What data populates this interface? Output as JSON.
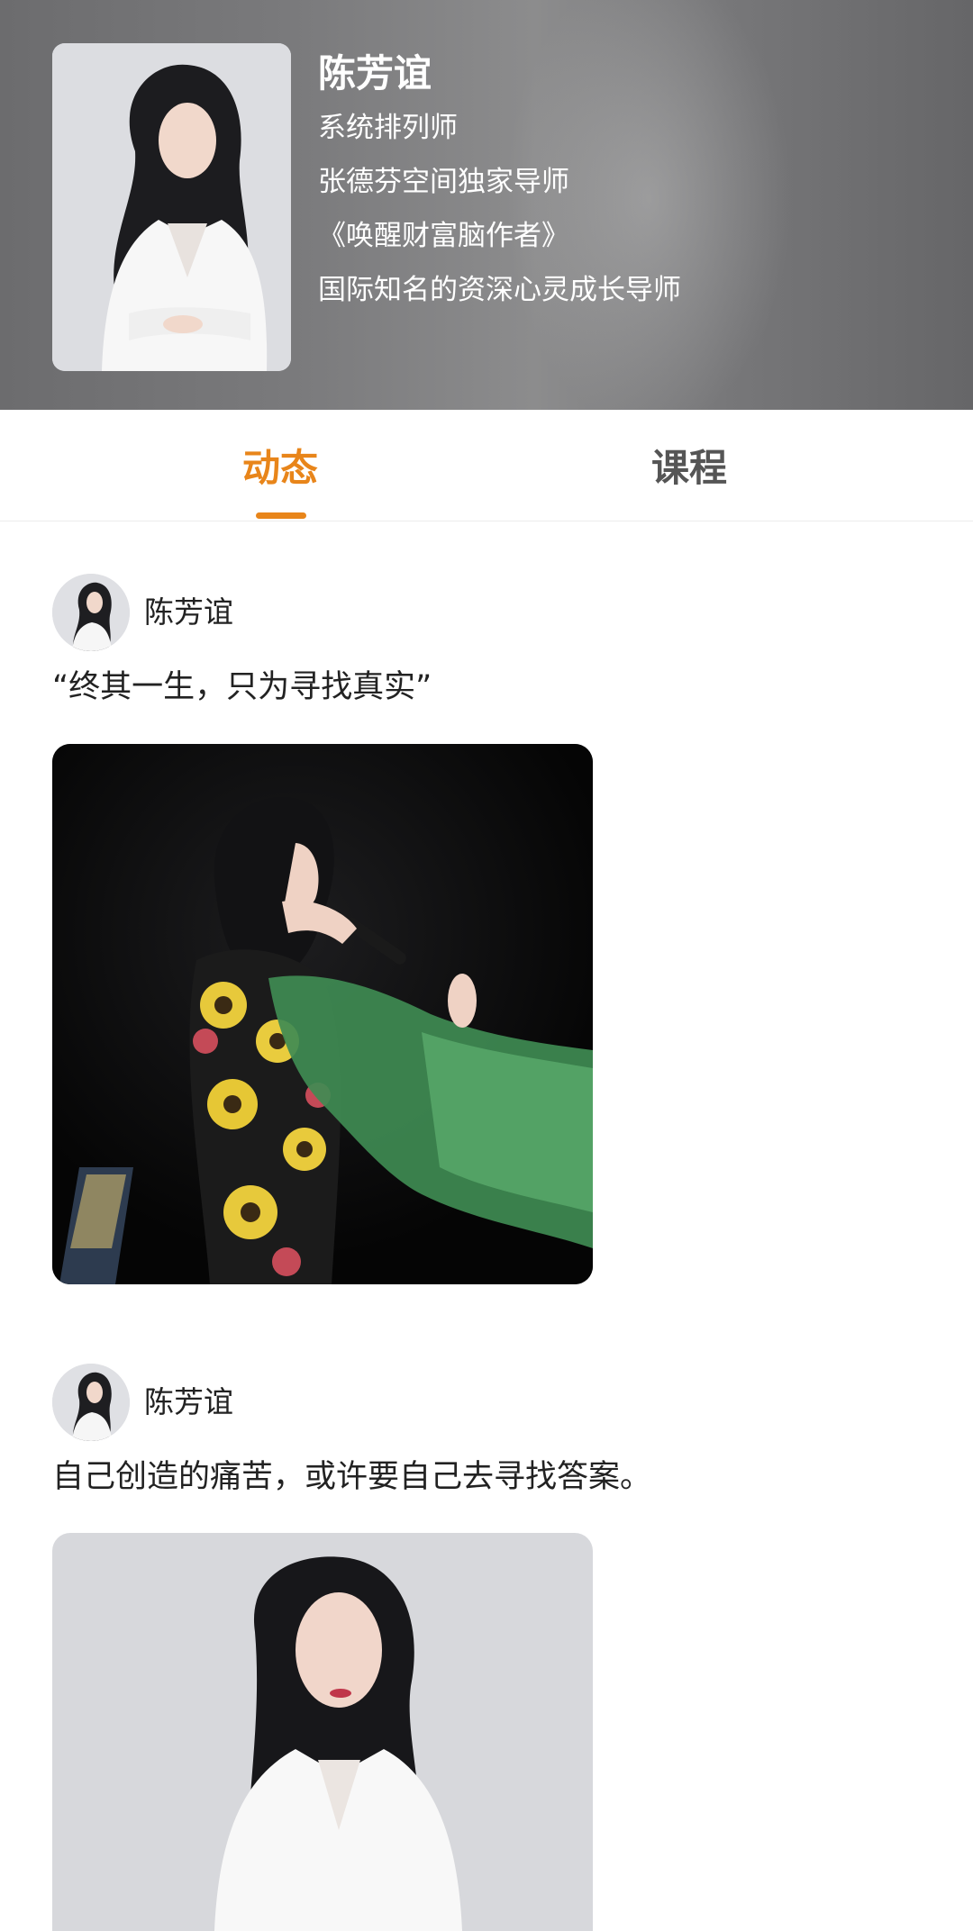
{
  "profile": {
    "name": "陈芳谊",
    "titles": [
      "系统排列师",
      "张德芬空间独家导师",
      "《唤醒财富脑作者》",
      "国际知名的资深心灵成长导师"
    ]
  },
  "tabs": [
    {
      "label": "动态",
      "active": true
    },
    {
      "label": "课程",
      "active": false
    }
  ],
  "posts": [
    {
      "author": "陈芳谊",
      "text": "“终其一生，只为寻找真实”"
    },
    {
      "author": "陈芳谊",
      "text": "自己创造的痛苦，或许要自己去寻找答案。"
    }
  ],
  "colors": {
    "accent": "#e8851a",
    "tab_inactive": "#555555",
    "body_text": "#222222"
  }
}
